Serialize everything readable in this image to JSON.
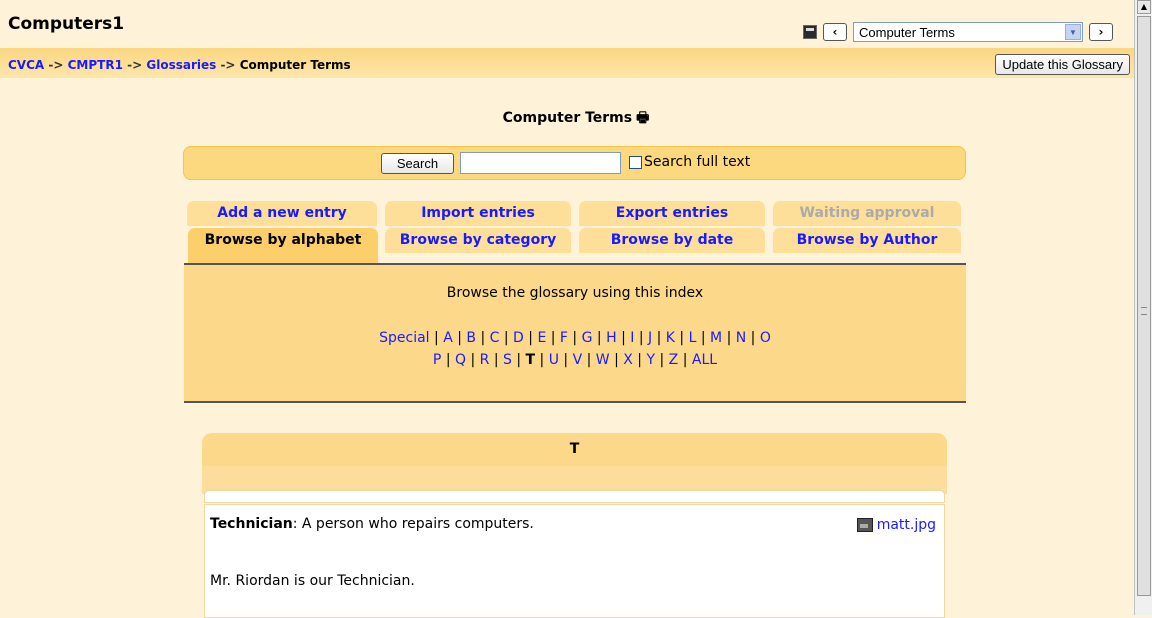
{
  "header": {
    "course_title": "Computers1",
    "jump_select_value": "Computer Terms",
    "prev_label": "‹",
    "next_label": "›"
  },
  "navbar": {
    "breadcrumb": [
      "CVCA",
      "CMPTR1",
      "Glossaries",
      "Computer Terms"
    ],
    "separator": "->",
    "update_button": "Update this Glossary"
  },
  "page_title": "Computer Terms",
  "search": {
    "button_label": "Search",
    "input_value": "",
    "fulltext_label": "Search full text",
    "fulltext_checked": false
  },
  "tabs": {
    "row1": [
      {
        "label": "Add a new entry",
        "enabled": true
      },
      {
        "label": "Import entries",
        "enabled": true
      },
      {
        "label": "Export entries",
        "enabled": true
      },
      {
        "label": "Waiting approval",
        "enabled": false
      }
    ],
    "row2": [
      {
        "label": "Browse by alphabet",
        "active": true
      },
      {
        "label": "Browse by category",
        "active": false
      },
      {
        "label": "Browse by date",
        "active": false
      },
      {
        "label": "Browse by Author",
        "active": false
      }
    ]
  },
  "index": {
    "intro": "Browse the glossary using this index",
    "line1": [
      "Special",
      "A",
      "B",
      "C",
      "D",
      "E",
      "F",
      "G",
      "H",
      "I",
      "J",
      "K",
      "L",
      "M",
      "N",
      "O"
    ],
    "line2": [
      "P",
      "Q",
      "R",
      "S",
      "T",
      "U",
      "V",
      "W",
      "X",
      "Y",
      "Z",
      "ALL"
    ],
    "selected": "T"
  },
  "letter_section": {
    "heading": "T",
    "entry": {
      "term": "Technician",
      "definition": ": A person who repairs computers.",
      "attachment": "matt.jpg",
      "note": "Mr. Riordan is our Technician."
    }
  },
  "colors": {
    "page_bg": "#fef2d9",
    "accent": "#fcd88a",
    "link": "#1a1aff"
  }
}
